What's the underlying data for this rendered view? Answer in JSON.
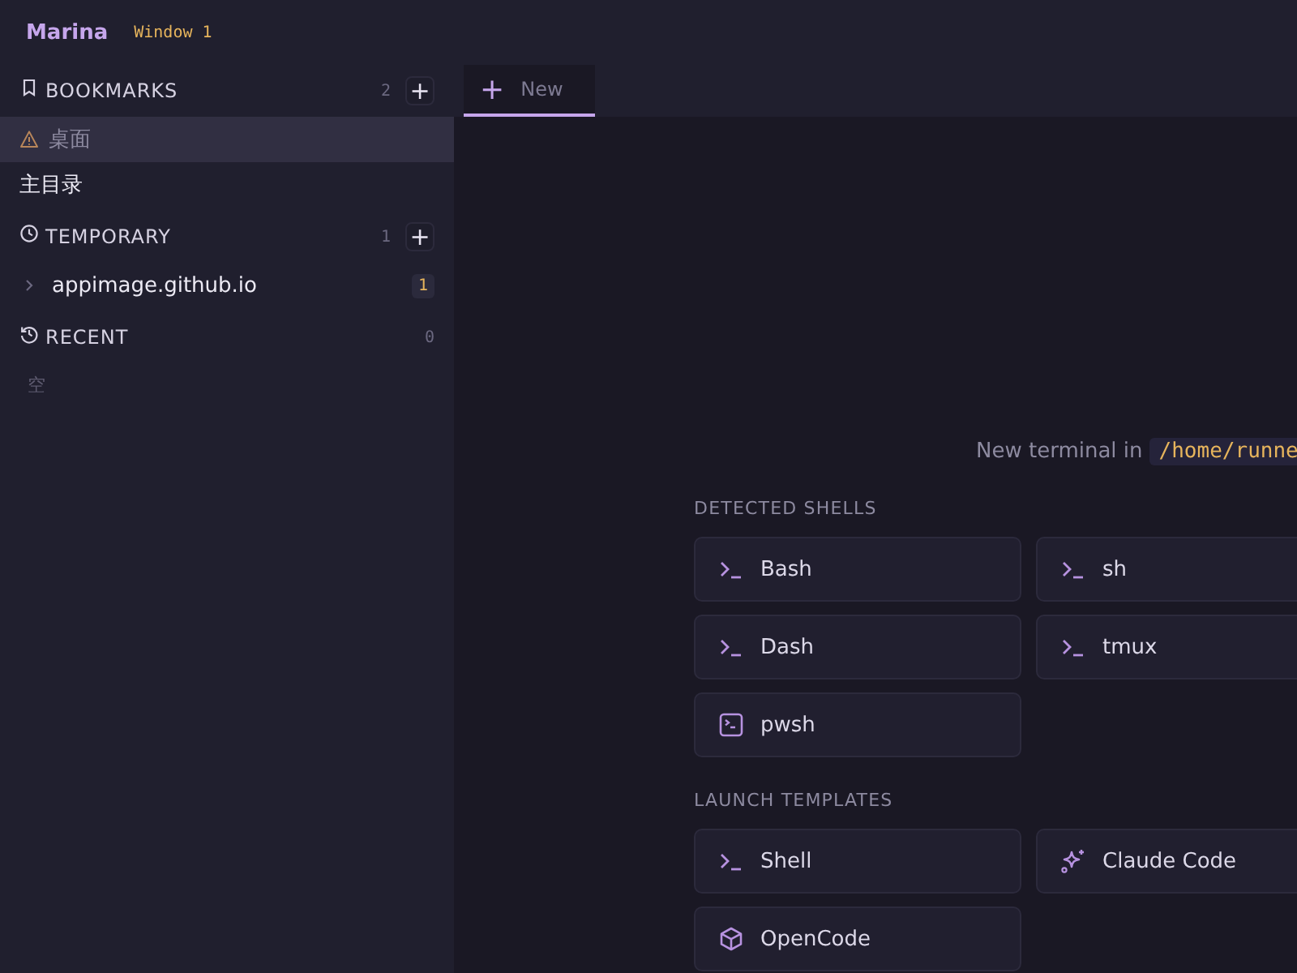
{
  "app": {
    "name": "Marina",
    "window_label": "Window 1"
  },
  "sidebar": {
    "sections": [
      {
        "kind": "bookmark",
        "title": "BOOKMARKS",
        "count": "2",
        "add": "+",
        "items": [
          {
            "label": "桌面",
            "selected": true,
            "warning": true
          },
          {
            "label": "主目录",
            "selected": false,
            "warning": false
          }
        ]
      },
      {
        "kind": "clock",
        "title": "TEMPORARY",
        "count": "1",
        "add": "+",
        "items": [
          {
            "label": "appimage.github.io",
            "selected": false,
            "warning": false,
            "expandable": true,
            "badge": "1"
          }
        ]
      },
      {
        "kind": "history",
        "title": "RECENT",
        "count": "0",
        "empty": "空"
      }
    ]
  },
  "tabs": [
    {
      "label": "New",
      "icon": "+",
      "selected": true
    }
  ],
  "launcher": {
    "prompt": "New terminal in",
    "path": "/home/runne",
    "groups": [
      {
        "title": "DETECTED SHELLS",
        "items": [
          {
            "kind": "terminal",
            "label": "Bash"
          },
          {
            "kind": "terminal",
            "label": "sh"
          },
          {
            "kind": "terminal",
            "label": "Dash"
          },
          {
            "kind": "terminal",
            "label": "tmux"
          },
          {
            "kind": "console",
            "label": "pwsh"
          }
        ]
      },
      {
        "title": "LAUNCH TEMPLATES",
        "items": [
          {
            "kind": "terminal",
            "label": "Shell"
          },
          {
            "kind": "sparkle",
            "label": "Claude Code"
          },
          {
            "kind": "cube",
            "label": "OpenCode"
          }
        ]
      }
    ]
  }
}
